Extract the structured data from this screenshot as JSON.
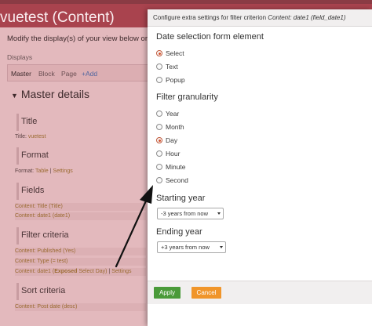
{
  "background": {
    "title": "vuetest (Content)",
    "intro": "Modify the display(s) of your view below or ad",
    "displays_label": "Displays",
    "tabs": [
      {
        "label": "Master",
        "active": true
      },
      {
        "label": "Block",
        "active": false
      },
      {
        "label": "Page",
        "active": false
      },
      {
        "label": "+Add",
        "active": false
      }
    ],
    "master_details": "Master details",
    "title_section": {
      "heading": "Title",
      "row_label": "Title:",
      "row_value": "vuetest"
    },
    "format_section": {
      "heading": "Format",
      "row_label": "Format:",
      "row_value": "Table",
      "row_sep": "|",
      "row_link": "Settings"
    },
    "fields_section": {
      "heading": "Fields",
      "rows": [
        "Content: Title (Title)",
        "Content: date1 (date1)"
      ]
    },
    "filter_section": {
      "heading": "Filter criteria",
      "rows": [
        "Content: Published (Yes)",
        "Content: Type (= test)"
      ],
      "exposed_row": {
        "prefix": "Content: date1 (",
        "bold": "Exposed",
        "suffix": " Select Day)",
        "sep": "|",
        "link": "Settings"
      }
    },
    "sort_section": {
      "heading": "Sort criteria",
      "rows": [
        "Content: Post date (desc)"
      ]
    }
  },
  "modal": {
    "header_prefix": "Configure extra settings for filter criterion",
    "header_italic": "Content: date1 (field_date1)",
    "date_form_group": {
      "title": "Date selection form element",
      "options": [
        {
          "label": "Select",
          "checked": true
        },
        {
          "label": "Text",
          "checked": false
        },
        {
          "label": "Popup",
          "checked": false
        }
      ]
    },
    "granularity_group": {
      "title": "Filter granularity",
      "options": [
        {
          "label": "Year",
          "checked": false
        },
        {
          "label": "Month",
          "checked": false
        },
        {
          "label": "Day",
          "checked": true
        },
        {
          "label": "Hour",
          "checked": false
        },
        {
          "label": "Minute",
          "checked": false
        },
        {
          "label": "Second",
          "checked": false
        }
      ]
    },
    "starting_year": {
      "title": "Starting year",
      "value": "-3 years from now"
    },
    "ending_year": {
      "title": "Ending year",
      "value": "+3 years from now"
    },
    "footer": {
      "apply_label": "Apply",
      "cancel_label": "Cancel"
    }
  },
  "colors": {
    "header_bg": "#a9434e",
    "apply_button": "#4a9a39",
    "cancel_button": "#f0952a",
    "radio_checked": "#d3532f"
  },
  "icons": {
    "select_arrow": "chevron-down-icon",
    "annotation": "arrow-icon"
  }
}
